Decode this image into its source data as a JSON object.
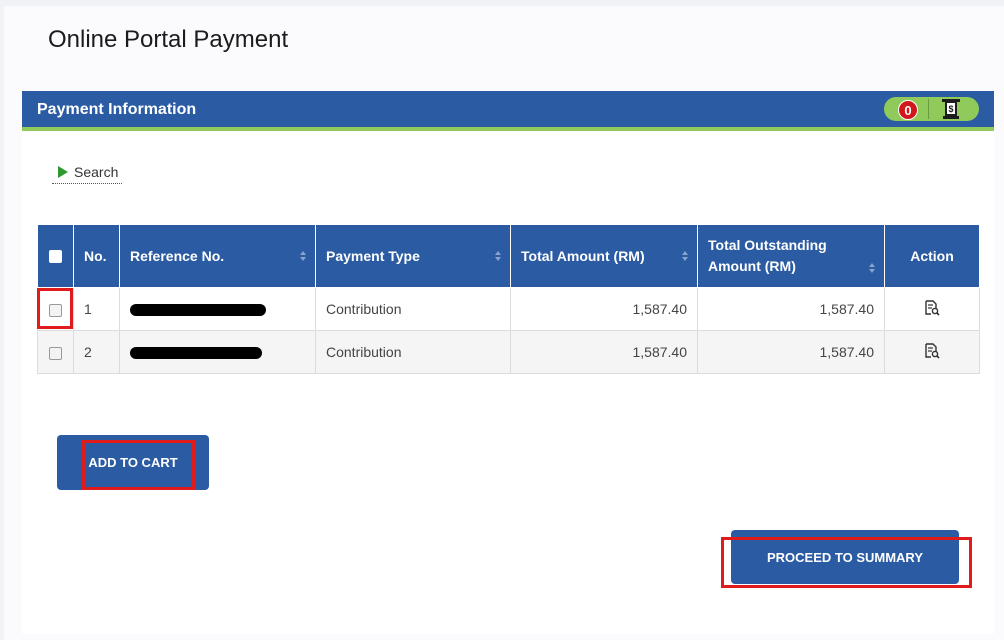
{
  "page": {
    "title": "Online Portal Payment"
  },
  "panel": {
    "title": "Payment Information",
    "cart_count": "0"
  },
  "search": {
    "label": "Search"
  },
  "table": {
    "columns": [
      "No.",
      "Reference No.",
      "Payment Type",
      "Total Amount (RM)",
      "Total Outstanding Amount (RM)",
      "Action"
    ],
    "rows": [
      {
        "no": "1",
        "payment_type": "Contribution",
        "total_amount": "1,587.40",
        "total_outstanding": "1,587.40"
      },
      {
        "no": "2",
        "payment_type": "Contribution",
        "total_amount": "1,587.40",
        "total_outstanding": "1,587.40"
      }
    ]
  },
  "buttons": {
    "add_to_cart": "ADD TO CART",
    "proceed": "PROCEED TO SUMMARY"
  },
  "colors": {
    "primary": "#2a5ba3",
    "accent_green": "#8fca5a",
    "badge_red": "#d0171b",
    "highlight_red": "#e01b1b"
  },
  "icons": {
    "cart": "cash-register-icon",
    "search_toggle": "play-triangle-icon",
    "action": "document-search-icon"
  }
}
